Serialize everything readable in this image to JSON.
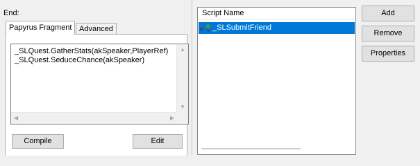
{
  "left_panel": {
    "end_label": "End:",
    "tabs": [
      {
        "label": "Papyrus Fragment",
        "active": true
      },
      {
        "label": "Advanced",
        "active": false
      }
    ],
    "code_lines": [
      "_SLQuest.GatherStats(akSpeaker,PlayerRef)",
      "_SLQuest.SeduceChance(akSpeaker)"
    ],
    "compile_label": "Compile",
    "edit_label": "Edit"
  },
  "scripts_list": {
    "header": "Script Name",
    "items": [
      {
        "name": "_SLSubmitFriend",
        "selected": true,
        "icon": "script-icon"
      }
    ]
  },
  "buttons": {
    "add_label": "Add",
    "remove_label": "Remove",
    "properties_label": "Properties"
  },
  "colors": {
    "selection": "#0078d7",
    "background": "#f0f0f0"
  }
}
